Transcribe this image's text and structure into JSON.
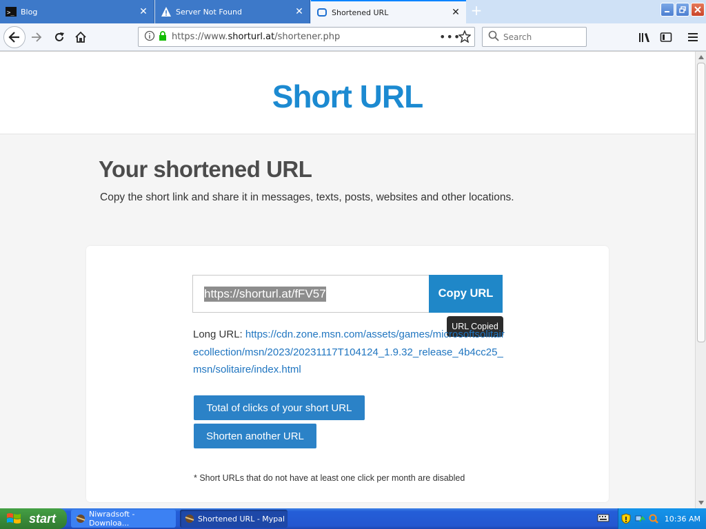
{
  "browser": {
    "tabs": [
      {
        "label": "Blog",
        "favicon": "terminal-icon",
        "active": false
      },
      {
        "label": "Server Not Found",
        "favicon": "warning-icon",
        "active": false
      },
      {
        "label": "Shortened URL",
        "favicon": "shorturl-icon",
        "active": true
      }
    ],
    "address": {
      "prefix": "https://www.",
      "domain": "shorturl.at",
      "path": "/shortener.php"
    },
    "search_placeholder": "Search"
  },
  "page": {
    "site_title": "Short URL",
    "heading": "Your shortened URL",
    "subtext": "Copy the short link and share it in messages, texts, posts, websites and other locations.",
    "short_url": "https://shorturl.at/fFV57",
    "copy_button": "Copy URL",
    "tooltip": "URL Copied",
    "long_url_label": "Long URL:",
    "long_url": "https://cdn.zone.msn.com/assets/games/microsoftsolitairecollection/msn/2023/20231117T104124_1.9.32_release_4b4cc25_msn/solitaire/index.html",
    "clicks_button": "Total of clicks of your short URL",
    "another_button": "Shorten another URL",
    "note": "* Short URLs that do not have at least one click per month are disabled"
  },
  "taskbar": {
    "start_label": "start",
    "tasks": [
      {
        "label": "Niwradsoft - Downloa..."
      },
      {
        "label": "Shortened URL - Mypal"
      }
    ],
    "clock": "10:36 AM"
  },
  "colors": {
    "brand": "#1c8ad1",
    "button": "#2b82c7",
    "link": "#1f75c0"
  }
}
